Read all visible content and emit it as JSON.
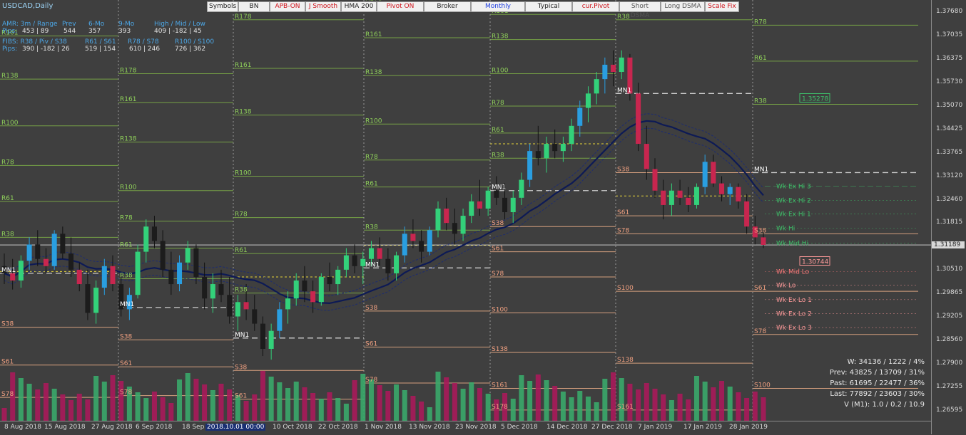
{
  "chart_title": "USDCAD,Daily",
  "toolbar": [
    {
      "label": "Symbols",
      "color": "#222222"
    },
    {
      "label": "BN",
      "color": "#222222"
    },
    {
      "label": "APB-ON",
      "color": "#d0141c"
    },
    {
      "label": "J Smooth",
      "color": "#d0141c"
    },
    {
      "label": "HMA 200",
      "color": "#222222"
    },
    {
      "label": "Pivot ON",
      "color": "#d0141c"
    },
    {
      "label": "Broker",
      "color": "#222222"
    },
    {
      "label": "Monthly",
      "color": "#1f3fe0"
    },
    {
      "label": "Typical",
      "color": "#222222"
    },
    {
      "label": "cur.Pivot",
      "color": "#d0141c"
    },
    {
      "label": "Short DSMA",
      "color": "#555555"
    },
    {
      "label": "Long DSMA",
      "color": "#555555"
    },
    {
      "label": "Scale Fix",
      "color": "#d0141c"
    }
  ],
  "stats_table": {
    "amr_headers": [
      "AMR: 3m / Range",
      "Prev",
      "6-Mo",
      "9-Mo",
      "High / Mid / Low"
    ],
    "amr_row_label": "Pips:",
    "amr_values": [
      "453 | 89",
      "544",
      "357",
      "393",
      "409  |  -182  |  45"
    ],
    "fibs_headers": [
      "FIBS: R38 / Piv / S38",
      "R61 / S61",
      "R78 / S78",
      "R100 / S100"
    ],
    "fibs_row_label": "Pips:",
    "fibs_values": [
      "390  |  -182  |  26",
      "519  |  154",
      "610  |  246",
      "726  |  362"
    ]
  },
  "stats_box": [
    "W: 34136 / 1222 / 4%",
    "Prev: 43825 / 13709 / 31%",
    "Past: 61695 / 22477 / 36%",
    "Last: 77892 / 23603 / 30%",
    "V (M1): 1.0 / 0.2 / 10.9"
  ],
  "weekly_labels": [
    {
      "text": "Wk Ex Hi 3",
      "color": "#3fc06a",
      "price": 1.3282
    },
    {
      "text": "Wk Ex Hi 2",
      "color": "#3fc06a",
      "price": 1.3243
    },
    {
      "text": "Wk Ex Hi 1",
      "color": "#3fc06a",
      "price": 1.3205
    },
    {
      "text": "Wk Hi",
      "color": "#3fc06a",
      "price": 1.3166
    },
    {
      "text": "Wk Mid Hi",
      "color": "#3fc06a",
      "price": 1.3124
    },
    {
      "text": "Wk Mid Lo",
      "color": "#ff7a7a",
      "price": 1.3045
    },
    {
      "text": "Wk Lo",
      "color": "#ff9a9a",
      "price": 1.3007
    },
    {
      "text": "Wk Ex Lo 1",
      "color": "#ff9a9a",
      "price": 1.2967
    },
    {
      "text": "Wk Ex Lo 2",
      "color": "#ff9a9a",
      "price": 1.2928
    },
    {
      "text": "Wk Ex Lo 3",
      "color": "#ff9a9a",
      "price": 1.2889
    }
  ],
  "marker_labels": [
    {
      "text": "1.35278",
      "price": 1.35278,
      "color": "#3fc06a"
    },
    {
      "text": "1.30744",
      "price": 1.30744,
      "color": "#ff9a9a"
    }
  ],
  "chart_data": {
    "type": "candlestick",
    "symbol": "USDCAD",
    "timeframe": "Daily",
    "ylim": [
      1.263,
      1.38
    ],
    "price_ticks": [
      "1.37680",
      "1.37035",
      "1.36375",
      "1.35730",
      "1.35070",
      "1.34425",
      "1.33765",
      "1.33120",
      "1.32460",
      "1.31815",
      "1.31189",
      "1.30510",
      "1.29865",
      "1.29205",
      "1.28560",
      "1.27900",
      "1.27255",
      "1.26595"
    ],
    "current_price": "1.31189",
    "time_ticks": [
      "8 Aug 2018",
      "15 Aug 2018",
      "27 Aug 2018",
      "6 Sep 2018",
      "18 Sep 2018",
      "2018.10.01 00:00",
      "10 Oct 2018",
      "22 Oct 2018",
      "1 Nov 2018",
      "13 Nov 2018",
      "23 Nov 2018",
      "5 Dec 2018",
      "14 Dec 2018",
      "27 Dec 2018",
      "7 Jan 2019",
      "17 Jan 2019",
      "28 Jan 2019"
    ],
    "month_separators": [
      "Aug 2018",
      "Sep 2018",
      "Oct 2018",
      "Nov 2018",
      "Dec 2018",
      "Jan 2019"
    ],
    "pivot_months": [
      {
        "month": "Aug 2018",
        "levels": {
          "R178": 1.382,
          "R161": 1.37,
          "R138": 1.358,
          "R100": 1.345,
          "R78": 1.334,
          "R61": 1.324,
          "R38": 1.314,
          "MN1": 1.304,
          "S38": 1.289,
          "S61": 1.2785,
          "S78": 1.2695,
          "S100": 1.2585
        }
      },
      {
        "month": "Sep 2018",
        "levels": {
          "R178": 1.3595,
          "R161": 1.3515,
          "R138": 1.3405,
          "R100": 1.327,
          "R78": 1.3185,
          "R61": 1.311,
          "R38": 1.3025,
          "MN1": 1.2945,
          "S38": 1.2855,
          "S61": 1.278,
          "S78": 1.27,
          "S100": 1.262
        }
      },
      {
        "month": "Oct 2018",
        "levels": {
          "R178": 1.3745,
          "R161": 1.361,
          "R138": 1.348,
          "R100": 1.331,
          "R78": 1.3195,
          "R61": 1.3095,
          "R38": 1.2985,
          "MN1": 1.286,
          "S38": 1.277,
          "S61": 1.269,
          "S78": 1.262
        }
      },
      {
        "month": "Nov 2018",
        "levels": {
          "R178": 1.3795,
          "R161": 1.3695,
          "R138": 1.359,
          "R100": 1.3455,
          "R78": 1.3355,
          "R61": 1.328,
          "R38": 1.316,
          "MN1": 1.3055,
          "S38": 1.2935,
          "S61": 1.2835,
          "S78": 1.2735
        }
      },
      {
        "month": "Dec 2018",
        "levels": {
          "R178": 1.3805,
          "R161": 1.376,
          "R138": 1.369,
          "R100": 1.3595,
          "R78": 1.3505,
          "R61": 1.343,
          "R38": 1.336,
          "MN1": 1.327,
          "S38": 1.317,
          "S61": 1.31,
          "S78": 1.303,
          "S100": 1.293,
          "S138": 1.282,
          "S161": 1.272,
          "S178": 1.266
        }
      },
      {
        "month": "Jan 2019",
        "levels": {
          "R38": 1.3745,
          "MN1": 1.354,
          "S38": 1.332,
          "S61": 1.32,
          "S78": 1.315,
          "S100": 1.299,
          "S138": 1.279,
          "S161": 1.266
        }
      },
      {
        "month": "Feb 2019",
        "levels": {
          "R78": 1.373,
          "R61": 1.363,
          "R38": 1.351,
          "MN1": 1.332,
          "S38": 1.315,
          "S61": 1.299,
          "S78": 1.287,
          "S100": 1.272
        }
      }
    ],
    "candles": [
      {
        "o": 1.306,
        "h": 1.3095,
        "l": 1.301,
        "c": 1.304
      },
      {
        "o": 1.304,
        "h": 1.308,
        "l": 1.2995,
        "c": 1.302
      },
      {
        "o": 1.302,
        "h": 1.309,
        "l": 1.3,
        "c": 1.3075
      },
      {
        "o": 1.3075,
        "h": 1.314,
        "l": 1.305,
        "c": 1.312
      },
      {
        "o": 1.312,
        "h": 1.316,
        "l": 1.306,
        "c": 1.308
      },
      {
        "o": 1.308,
        "h": 1.311,
        "l": 1.304,
        "c": 1.306
      },
      {
        "o": 1.306,
        "h": 1.316,
        "l": 1.305,
        "c": 1.315
      },
      {
        "o": 1.315,
        "h": 1.317,
        "l": 1.308,
        "c": 1.3095
      },
      {
        "o": 1.3095,
        "h": 1.314,
        "l": 1.303,
        "c": 1.305
      },
      {
        "o": 1.305,
        "h": 1.307,
        "l": 1.299,
        "c": 1.301
      },
      {
        "o": 1.301,
        "h": 1.305,
        "l": 1.291,
        "c": 1.293
      },
      {
        "o": 1.293,
        "h": 1.302,
        "l": 1.29,
        "c": 1.3
      },
      {
        "o": 1.3,
        "h": 1.308,
        "l": 1.298,
        "c": 1.306
      },
      {
        "o": 1.306,
        "h": 1.309,
        "l": 1.299,
        "c": 1.301
      },
      {
        "o": 1.301,
        "h": 1.303,
        "l": 1.292,
        "c": 1.294
      },
      {
        "o": 1.294,
        "h": 1.3,
        "l": 1.291,
        "c": 1.298
      },
      {
        "o": 1.298,
        "h": 1.312,
        "l": 1.297,
        "c": 1.31
      },
      {
        "o": 1.31,
        "h": 1.319,
        "l": 1.307,
        "c": 1.317
      },
      {
        "o": 1.317,
        "h": 1.32,
        "l": 1.311,
        "c": 1.313
      },
      {
        "o": 1.313,
        "h": 1.316,
        "l": 1.303,
        "c": 1.305
      },
      {
        "o": 1.305,
        "h": 1.31,
        "l": 1.298,
        "c": 1.301
      },
      {
        "o": 1.301,
        "h": 1.309,
        "l": 1.299,
        "c": 1.307
      },
      {
        "o": 1.307,
        "h": 1.313,
        "l": 1.305,
        "c": 1.311
      },
      {
        "o": 1.311,
        "h": 1.312,
        "l": 1.301,
        "c": 1.303
      },
      {
        "o": 1.303,
        "h": 1.307,
        "l": 1.294,
        "c": 1.297
      },
      {
        "o": 1.297,
        "h": 1.304,
        "l": 1.293,
        "c": 1.301
      },
      {
        "o": 1.301,
        "h": 1.305,
        "l": 1.296,
        "c": 1.298
      },
      {
        "o": 1.298,
        "h": 1.303,
        "l": 1.29,
        "c": 1.292
      },
      {
        "o": 1.292,
        "h": 1.298,
        "l": 1.288,
        "c": 1.296
      },
      {
        "o": 1.296,
        "h": 1.301,
        "l": 1.291,
        "c": 1.294
      },
      {
        "o": 1.294,
        "h": 1.298,
        "l": 1.288,
        "c": 1.29
      },
      {
        "o": 1.29,
        "h": 1.292,
        "l": 1.281,
        "c": 1.283
      },
      {
        "o": 1.283,
        "h": 1.29,
        "l": 1.28,
        "c": 1.288
      },
      {
        "o": 1.288,
        "h": 1.296,
        "l": 1.286,
        "c": 1.294
      },
      {
        "o": 1.294,
        "h": 1.299,
        "l": 1.29,
        "c": 1.297
      },
      {
        "o": 1.297,
        "h": 1.304,
        "l": 1.295,
        "c": 1.302
      },
      {
        "o": 1.302,
        "h": 1.306,
        "l": 1.296,
        "c": 1.299
      },
      {
        "o": 1.299,
        "h": 1.302,
        "l": 1.293,
        "c": 1.296
      },
      {
        "o": 1.296,
        "h": 1.304,
        "l": 1.295,
        "c": 1.303
      },
      {
        "o": 1.303,
        "h": 1.307,
        "l": 1.299,
        "c": 1.301
      },
      {
        "o": 1.301,
        "h": 1.306,
        "l": 1.298,
        "c": 1.305
      },
      {
        "o": 1.305,
        "h": 1.311,
        "l": 1.303,
        "c": 1.309
      },
      {
        "o": 1.309,
        "h": 1.312,
        "l": 1.304,
        "c": 1.306
      },
      {
        "o": 1.306,
        "h": 1.31,
        "l": 1.301,
        "c": 1.308
      },
      {
        "o": 1.308,
        "h": 1.313,
        "l": 1.306,
        "c": 1.311
      },
      {
        "o": 1.311,
        "h": 1.314,
        "l": 1.306,
        "c": 1.308
      },
      {
        "o": 1.308,
        "h": 1.311,
        "l": 1.302,
        "c": 1.304
      },
      {
        "o": 1.304,
        "h": 1.31,
        "l": 1.302,
        "c": 1.309
      },
      {
        "o": 1.309,
        "h": 1.317,
        "l": 1.307,
        "c": 1.315
      },
      {
        "o": 1.315,
        "h": 1.319,
        "l": 1.311,
        "c": 1.313
      },
      {
        "o": 1.313,
        "h": 1.316,
        "l": 1.307,
        "c": 1.31
      },
      {
        "o": 1.31,
        "h": 1.317,
        "l": 1.309,
        "c": 1.316
      },
      {
        "o": 1.316,
        "h": 1.324,
        "l": 1.314,
        "c": 1.322
      },
      {
        "o": 1.322,
        "h": 1.325,
        "l": 1.316,
        "c": 1.318
      },
      {
        "o": 1.318,
        "h": 1.322,
        "l": 1.312,
        "c": 1.315
      },
      {
        "o": 1.315,
        "h": 1.322,
        "l": 1.313,
        "c": 1.32
      },
      {
        "o": 1.32,
        "h": 1.326,
        "l": 1.318,
        "c": 1.324
      },
      {
        "o": 1.324,
        "h": 1.33,
        "l": 1.32,
        "c": 1.322
      },
      {
        "o": 1.322,
        "h": 1.328,
        "l": 1.32,
        "c": 1.327
      },
      {
        "o": 1.327,
        "h": 1.331,
        "l": 1.323,
        "c": 1.325
      },
      {
        "o": 1.325,
        "h": 1.329,
        "l": 1.319,
        "c": 1.321
      },
      {
        "o": 1.321,
        "h": 1.327,
        "l": 1.318,
        "c": 1.325
      },
      {
        "o": 1.325,
        "h": 1.332,
        "l": 1.323,
        "c": 1.33
      },
      {
        "o": 1.33,
        "h": 1.34,
        "l": 1.328,
        "c": 1.338
      },
      {
        "o": 1.338,
        "h": 1.345,
        "l": 1.334,
        "c": 1.336
      },
      {
        "o": 1.336,
        "h": 1.342,
        "l": 1.332,
        "c": 1.34
      },
      {
        "o": 1.34,
        "h": 1.344,
        "l": 1.336,
        "c": 1.338
      },
      {
        "o": 1.338,
        "h": 1.342,
        "l": 1.335,
        "c": 1.34
      },
      {
        "o": 1.34,
        "h": 1.347,
        "l": 1.338,
        "c": 1.345
      },
      {
        "o": 1.345,
        "h": 1.352,
        "l": 1.342,
        "c": 1.35
      },
      {
        "o": 1.35,
        "h": 1.356,
        "l": 1.346,
        "c": 1.354
      },
      {
        "o": 1.354,
        "h": 1.36,
        "l": 1.351,
        "c": 1.358
      },
      {
        "o": 1.358,
        "h": 1.364,
        "l": 1.354,
        "c": 1.362
      },
      {
        "o": 1.362,
        "h": 1.366,
        "l": 1.356,
        "c": 1.36
      },
      {
        "o": 1.36,
        "h": 1.366,
        "l": 1.358,
        "c": 1.364
      },
      {
        "o": 1.364,
        "h": 1.365,
        "l": 1.352,
        "c": 1.354
      },
      {
        "o": 1.354,
        "h": 1.357,
        "l": 1.338,
        "c": 1.34
      },
      {
        "o": 1.34,
        "h": 1.345,
        "l": 1.33,
        "c": 1.333
      },
      {
        "o": 1.333,
        "h": 1.336,
        "l": 1.325,
        "c": 1.327
      },
      {
        "o": 1.327,
        "h": 1.33,
        "l": 1.319,
        "c": 1.323
      },
      {
        "o": 1.323,
        "h": 1.329,
        "l": 1.32,
        "c": 1.327
      },
      {
        "o": 1.327,
        "h": 1.33,
        "l": 1.323,
        "c": 1.325
      },
      {
        "o": 1.325,
        "h": 1.328,
        "l": 1.321,
        "c": 1.323
      },
      {
        "o": 1.323,
        "h": 1.329,
        "l": 1.322,
        "c": 1.328
      },
      {
        "o": 1.328,
        "h": 1.337,
        "l": 1.326,
        "c": 1.335
      },
      {
        "o": 1.335,
        "h": 1.337,
        "l": 1.328,
        "c": 1.329
      },
      {
        "o": 1.329,
        "h": 1.331,
        "l": 1.324,
        "c": 1.326
      },
      {
        "o": 1.326,
        "h": 1.329,
        "l": 1.323,
        "c": 1.328
      },
      {
        "o": 1.328,
        "h": 1.329,
        "l": 1.322,
        "c": 1.324
      },
      {
        "o": 1.324,
        "h": 1.326,
        "l": 1.315,
        "c": 1.317
      },
      {
        "o": 1.317,
        "h": 1.32,
        "l": 1.312,
        "c": 1.314
      },
      {
        "o": 1.314,
        "h": 1.316,
        "l": 1.311,
        "c": 1.3119
      }
    ]
  }
}
